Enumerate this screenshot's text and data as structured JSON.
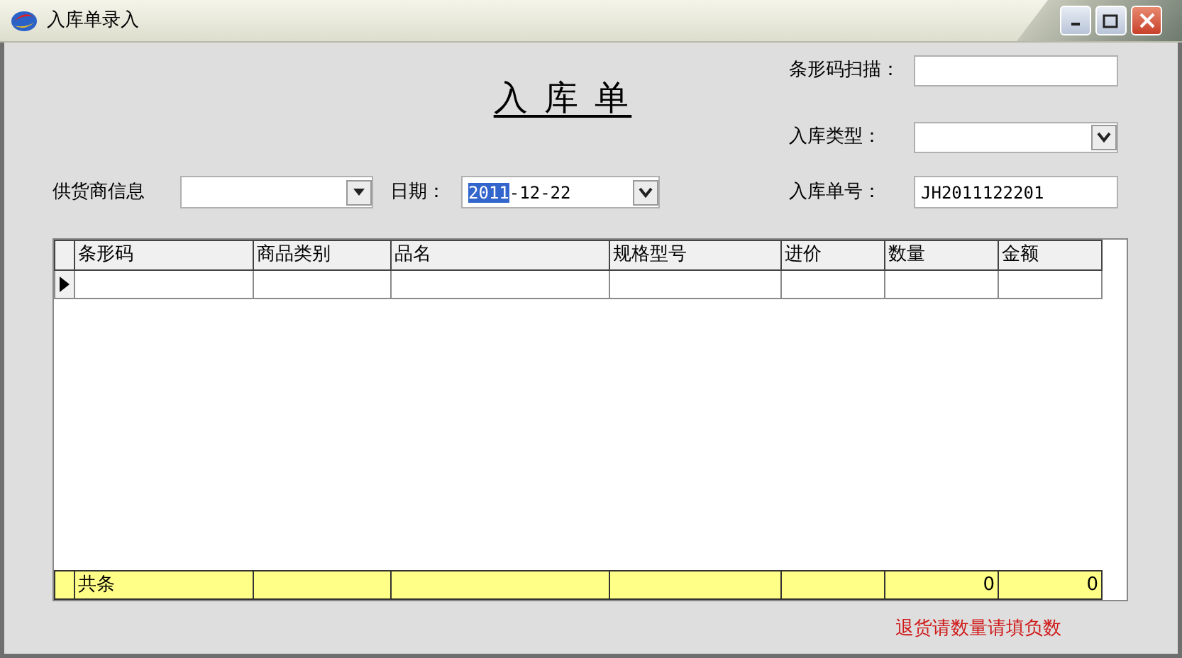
{
  "window": {
    "title": "入库单录入"
  },
  "form_title": "入 库 单",
  "barcode_scan": {
    "label": "条形码扫描："
  },
  "stock_in_type": {
    "label": "入库类型："
  },
  "supplier": {
    "label": "供货商信息"
  },
  "date": {
    "label": "日期：",
    "value_selected": "2011",
    "value_rest": "-12-22"
  },
  "order_no": {
    "label": "入库单号：",
    "value": "JH2011122201"
  },
  "table": {
    "columns": [
      "条形码",
      "商品类别",
      "品名",
      "规格型号",
      "进价",
      "数量",
      "金额"
    ],
    "rows": [
      {
        "current": true
      }
    ],
    "footer": {
      "label": "共条",
      "quantity_total": "0",
      "amount_total": "0"
    }
  },
  "note": "退货请数量请填负数"
}
